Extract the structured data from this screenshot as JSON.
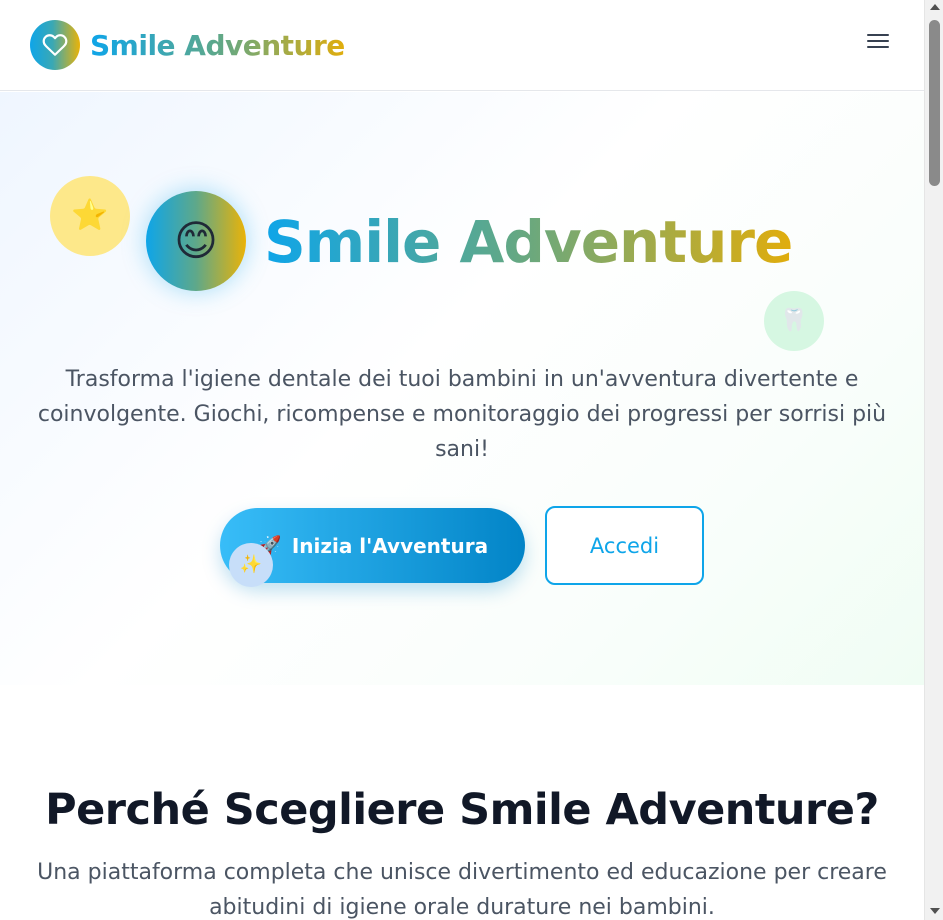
{
  "navbar": {
    "brand_name": "Smile Adventure",
    "brand_icon": "heart-icon",
    "menu_icon": "hamburger-menu-icon"
  },
  "hero": {
    "title": "Smile Adventure",
    "logo_emoji": "😊",
    "star_emoji": "⭐",
    "tooth_emoji": "🦷",
    "sparkle_emoji": "✨",
    "subtitle": "Trasforma l'igiene dentale dei tuoi bambini in un'avventura divertente e coinvolgente. Giochi, ricompense e monitoraggio dei progressi per sorrisi più sani!",
    "primary_button": {
      "icon": "🚀",
      "label": "Inizia l'Avventura"
    },
    "secondary_button": {
      "label": "Accedi"
    }
  },
  "features": {
    "title": "Perché Scegliere Smile Adventure?",
    "subtitle": "Una piattaforma completa che unisce divertimento ed educazione per creare abitudini di igiene orale durature nei bambini."
  },
  "colors": {
    "accent": "#0ea5e9",
    "accent_dark": "#0284c7",
    "gold": "#eab308",
    "text_dark": "#111827",
    "text_muted": "#4b5563"
  }
}
